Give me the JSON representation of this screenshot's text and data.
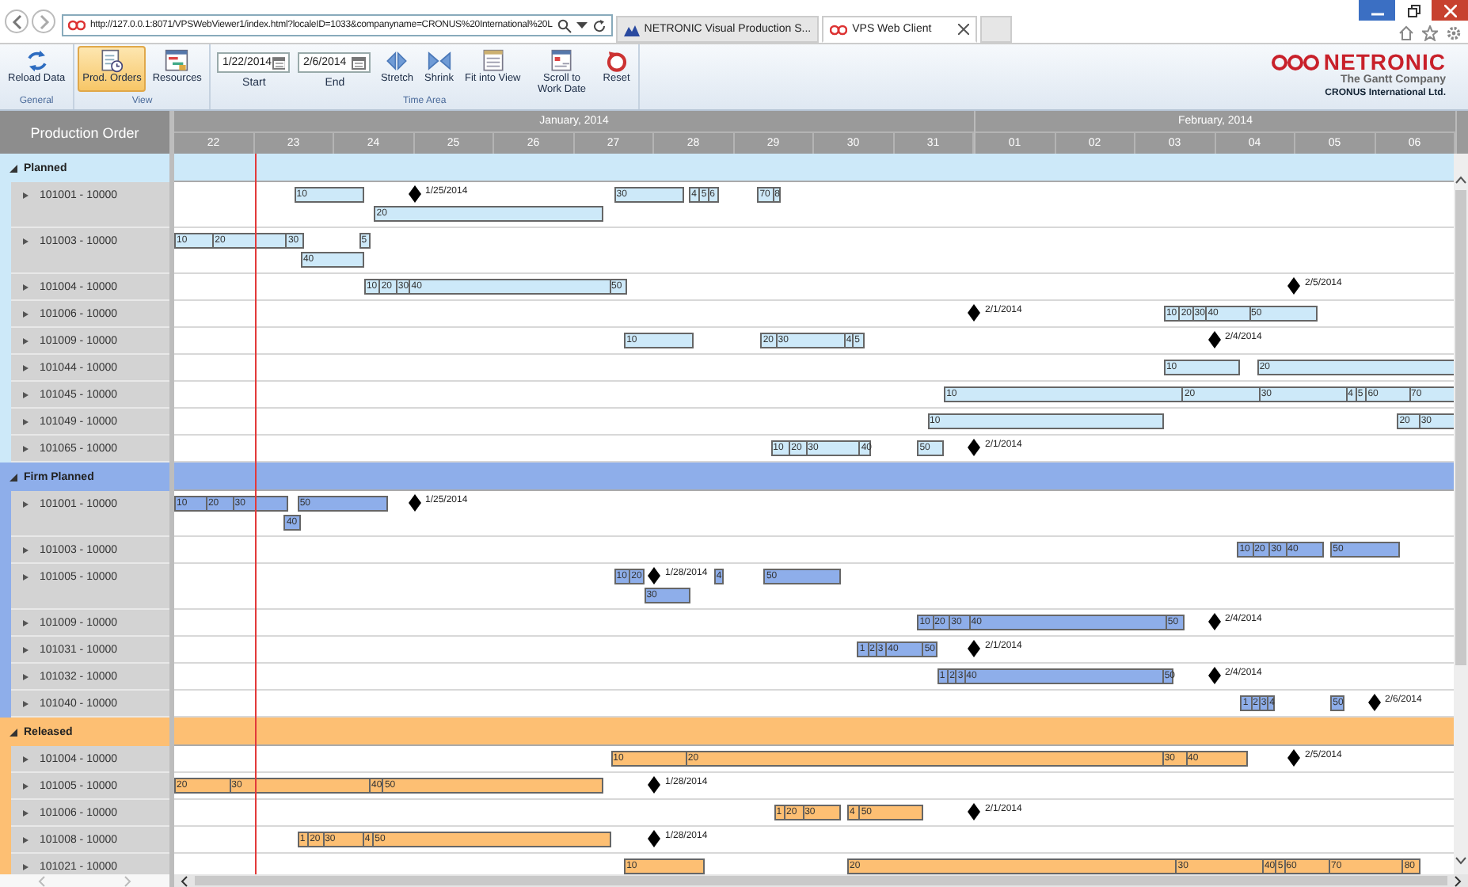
{
  "browser": {
    "url": "http://127.0.0.1:8071/VPSWebViewer1/index.html?localeID=1033&companyname=CRONUS%20International%20L",
    "tabs": [
      {
        "title": "NETRONIC Visual Production S...",
        "selected": false
      },
      {
        "title": "VPS Web Client",
        "selected": true
      }
    ]
  },
  "ribbon": {
    "groups": [
      {
        "label": "General",
        "items": [
          {
            "kind": "button",
            "label": "Reload Data",
            "selected": false
          }
        ]
      },
      {
        "label": "View",
        "items": [
          {
            "kind": "button",
            "label": "Prod. Orders",
            "selected": true
          },
          {
            "kind": "button",
            "label": "Resources",
            "selected": false
          }
        ]
      },
      {
        "label": "Time Area",
        "items": [
          {
            "kind": "date",
            "value": "1/22/2014",
            "caption": "Start"
          },
          {
            "kind": "date",
            "value": "2/6/2014",
            "caption": "End"
          },
          {
            "kind": "button",
            "label": "Stretch",
            "selected": false
          },
          {
            "kind": "button",
            "label": "Shrink",
            "selected": false
          },
          {
            "kind": "button",
            "label": "Fit into View",
            "selected": false
          },
          {
            "kind": "button",
            "label": "Scroll to Work Date",
            "selected": false
          },
          {
            "kind": "button",
            "label": "Reset",
            "selected": false
          }
        ]
      }
    ],
    "logo": {
      "name": "NETRONIC",
      "tagline": "The Gantt Company"
    },
    "company": "CRONUS International Ltd."
  },
  "gantt": {
    "column_title": "Production Order",
    "months": [
      {
        "label": "January, 2014",
        "days": [
          "22",
          "23",
          "24",
          "25",
          "26",
          "27",
          "28",
          "29",
          "30",
          "31"
        ]
      },
      {
        "label": "February, 2014",
        "days": [
          "01",
          "02",
          "03",
          "04",
          "05",
          "06"
        ]
      }
    ],
    "groups": [
      {
        "label": "Planned",
        "expanded": true,
        "color": "#cde9f9",
        "rows": [
          {
            "label": "101001 - 10000",
            "expanded": false,
            "milestone": {
              "label": "1/25/2014"
            },
            "lanes": [
              [
                {
                  "ops": [
                    {
                      "label": "10"
                    }
                  ]
                },
                {
                  "ops": [
                    {
                      "label": "30"
                    }
                  ]
                },
                {
                  "ops": [
                    {
                      "label": "4"
                    },
                    {
                      "label": "5"
                    },
                    {
                      "label": "6"
                    }
                  ]
                },
                {
                  "ops": [
                    {
                      "label": "70"
                    },
                    {
                      "label": "8"
                    }
                  ]
                }
              ],
              [
                {
                  "ops": [
                    {
                      "label": "20"
                    }
                  ]
                }
              ]
            ]
          },
          {
            "label": "101003 - 10000",
            "expanded": false,
            "lanes": [
              [
                {
                  "ops": [
                    {
                      "label": "10"
                    },
                    {
                      "label": "20"
                    },
                    {
                      "label": "30"
                    }
                  ]
                },
                {
                  "ops": [
                    {
                      "label": "5"
                    }
                  ]
                }
              ],
              [
                {
                  "ops": [
                    {
                      "label": "40"
                    }
                  ]
                }
              ]
            ]
          },
          {
            "label": "101004 - 10000",
            "expanded": false,
            "milestone": {
              "label": "2/5/2014"
            },
            "lanes": [
              [
                {
                  "ops": [
                    {
                      "label": "10"
                    },
                    {
                      "label": "20"
                    },
                    {
                      "label": "30"
                    },
                    {
                      "label": "40"
                    },
                    {
                      "label": "50"
                    }
                  ]
                }
              ]
            ]
          },
          {
            "label": "101006 - 10000",
            "expanded": false,
            "milestone": {
              "label": "2/1/2014"
            },
            "lanes": [
              [
                {
                  "ops": [
                    {
                      "label": "10"
                    },
                    {
                      "label": "20"
                    },
                    {
                      "label": "30"
                    },
                    {
                      "label": "40"
                    },
                    {
                      "label": "50"
                    }
                  ]
                }
              ]
            ]
          },
          {
            "label": "101009 - 10000",
            "expanded": false,
            "milestone": {
              "label": "2/4/2014"
            },
            "lanes": [
              [
                {
                  "ops": [
                    {
                      "label": "10"
                    }
                  ]
                },
                {
                  "ops": [
                    {
                      "label": "20"
                    },
                    {
                      "label": "30"
                    },
                    {
                      "label": "4"
                    },
                    {
                      "label": "5"
                    }
                  ]
                }
              ]
            ]
          },
          {
            "label": "101044 - 10000",
            "expanded": false,
            "lanes": [
              [
                {
                  "ops": [
                    {
                      "label": "10"
                    }
                  ]
                },
                {
                  "ops": [
                    {
                      "label": "20"
                    }
                  ]
                }
              ]
            ]
          },
          {
            "label": "101045 - 10000",
            "expanded": false,
            "lanes": [
              [
                {
                  "ops": [
                    {
                      "label": "10"
                    },
                    {
                      "label": "20"
                    },
                    {
                      "label": "30"
                    },
                    {
                      "label": "4"
                    },
                    {
                      "label": "5"
                    },
                    {
                      "label": "60"
                    },
                    {
                      "label": "70"
                    }
                  ]
                }
              ]
            ]
          },
          {
            "label": "101049 - 10000",
            "expanded": false,
            "lanes": [
              [
                {
                  "ops": [
                    {
                      "label": "10"
                    }
                  ]
                },
                {
                  "ops": [
                    {
                      "label": "20"
                    },
                    {
                      "label": "30"
                    }
                  ]
                }
              ]
            ]
          },
          {
            "label": "101065 - 10000",
            "expanded": false,
            "milestone": {
              "label": "2/1/2014"
            },
            "lanes": [
              [
                {
                  "ops": [
                    {
                      "label": "10"
                    },
                    {
                      "label": "20"
                    },
                    {
                      "label": "30"
                    },
                    {
                      "label": "40"
                    }
                  ]
                },
                {
                  "ops": [
                    {
                      "label": "50"
                    }
                  ]
                }
              ]
            ]
          }
        ]
      },
      {
        "label": "Firm Planned",
        "expanded": true,
        "color": "#8eaeea",
        "rows": [
          {
            "label": "101001 - 10000",
            "expanded": false,
            "milestone": {
              "label": "1/25/2014"
            },
            "lanes": [
              [
                {
                  "ops": [
                    {
                      "label": "10"
                    },
                    {
                      "label": "20"
                    },
                    {
                      "label": "30"
                    }
                  ]
                },
                {
                  "ops": [
                    {
                      "label": "50"
                    }
                  ]
                }
              ],
              [
                {
                  "ops": [
                    {
                      "label": "40"
                    }
                  ]
                }
              ]
            ]
          },
          {
            "label": "101003 - 10000",
            "expanded": false,
            "lanes": [
              [
                {
                  "ops": [
                    {
                      "label": "10"
                    },
                    {
                      "label": "20"
                    },
                    {
                      "label": "30"
                    },
                    {
                      "label": "40"
                    }
                  ]
                },
                {
                  "ops": [
                    {
                      "label": "50"
                    }
                  ]
                }
              ]
            ]
          },
          {
            "label": "101005 - 10000",
            "expanded": false,
            "milestone": {
              "label": "1/28/2014"
            },
            "lanes": [
              [
                {
                  "ops": [
                    {
                      "label": "10"
                    },
                    {
                      "label": "20"
                    }
                  ]
                },
                {
                  "ops": [
                    {
                      "label": "4"
                    }
                  ]
                },
                {
                  "ops": [
                    {
                      "label": "50"
                    }
                  ]
                }
              ],
              [
                {
                  "ops": [
                    {
                      "label": "30"
                    }
                  ]
                }
              ]
            ]
          },
          {
            "label": "101009 - 10000",
            "expanded": false,
            "milestone": {
              "label": "2/4/2014"
            },
            "lanes": [
              [
                {
                  "ops": [
                    {
                      "label": "10"
                    },
                    {
                      "label": "20"
                    },
                    {
                      "label": "30"
                    },
                    {
                      "label": "40"
                    },
                    {
                      "label": "50"
                    }
                  ]
                }
              ]
            ]
          },
          {
            "label": "101031 - 10000",
            "expanded": false,
            "milestone": {
              "label": "2/1/2014"
            },
            "lanes": [
              [
                {
                  "ops": [
                    {
                      "label": "1"
                    },
                    {
                      "label": "2"
                    },
                    {
                      "label": "3"
                    },
                    {
                      "label": "40"
                    },
                    {
                      "label": "50"
                    }
                  ]
                }
              ]
            ]
          },
          {
            "label": "101032 - 10000",
            "expanded": false,
            "milestone": {
              "label": "2/4/2014"
            },
            "lanes": [
              [
                {
                  "ops": [
                    {
                      "label": "1"
                    },
                    {
                      "label": "2"
                    },
                    {
                      "label": "3"
                    },
                    {
                      "label": "40"
                    },
                    {
                      "label": "50"
                    }
                  ]
                }
              ]
            ]
          },
          {
            "label": "101040 - 10000",
            "expanded": false,
            "milestone": {
              "label": "2/6/2014"
            },
            "lanes": [
              [
                {
                  "ops": [
                    {
                      "label": "1"
                    },
                    {
                      "label": "2"
                    },
                    {
                      "label": "3"
                    },
                    {
                      "label": "4"
                    }
                  ]
                },
                {
                  "ops": [
                    {
                      "label": "50"
                    }
                  ]
                }
              ]
            ]
          }
        ]
      },
      {
        "label": "Released",
        "expanded": true,
        "color": "#fdbf73",
        "rows": [
          {
            "label": "101004 - 10000",
            "expanded": false,
            "milestone": {
              "label": "2/5/2014"
            },
            "lanes": [
              [
                {
                  "ops": [
                    {
                      "label": "10"
                    },
                    {
                      "label": "20"
                    },
                    {
                      "label": "30"
                    },
                    {
                      "label": "40"
                    }
                  ]
                }
              ]
            ]
          },
          {
            "label": "101005 - 10000",
            "expanded": false,
            "milestone": {
              "label": "1/28/2014"
            },
            "lanes": [
              [
                {
                  "ops": [
                    {
                      "label": "20"
                    },
                    {
                      "label": "30"
                    },
                    {
                      "label": "40"
                    },
                    {
                      "label": "50"
                    }
                  ]
                }
              ]
            ]
          },
          {
            "label": "101006 - 10000",
            "expanded": false,
            "milestone": {
              "label": "2/1/2014"
            },
            "lanes": [
              [
                {
                  "ops": [
                    {
                      "label": "1"
                    },
                    {
                      "label": "20"
                    },
                    {
                      "label": "30"
                    }
                  ]
                },
                {
                  "ops": [
                    {
                      "label": "4"
                    },
                    {
                      "label": "50"
                    }
                  ]
                }
              ]
            ]
          },
          {
            "label": "101008 - 10000",
            "expanded": false,
            "milestone": {
              "label": "1/28/2014"
            },
            "lanes": [
              [
                {
                  "ops": [
                    {
                      "label": "1"
                    },
                    {
                      "label": "20"
                    },
                    {
                      "label": "30"
                    },
                    {
                      "label": "4"
                    },
                    {
                      "label": "50"
                    }
                  ]
                }
              ]
            ]
          },
          {
            "label": "101021 - 10000",
            "expanded": false,
            "lanes": [
              [
                {
                  "ops": [
                    {
                      "label": "10"
                    }
                  ]
                },
                {
                  "ops": [
                    {
                      "label": "20"
                    },
                    {
                      "label": "30"
                    },
                    {
                      "label": "40"
                    },
                    {
                      "label": "5"
                    },
                    {
                      "label": "60"
                    },
                    {
                      "label": "70"
                    },
                    {
                      "label": "80"
                    }
                  ]
                }
              ]
            ]
          }
        ]
      }
    ]
  }
}
